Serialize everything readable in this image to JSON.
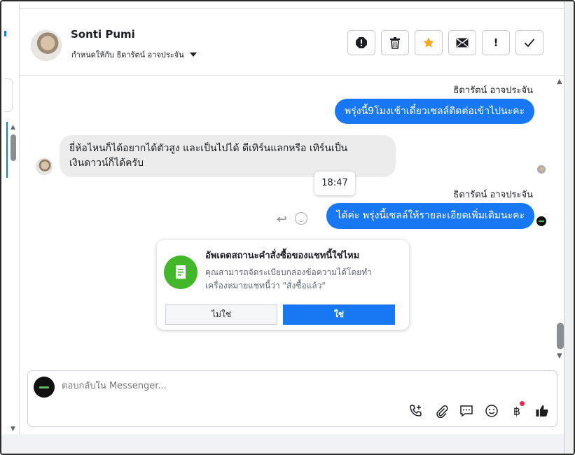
{
  "header": {
    "contact_name": "Sonti Pumi",
    "assign_label": "กำหนดให้กับ ธิดารัตน์ อาจประจัน",
    "actions": [
      {
        "icon": "alert-circle-icon",
        "glyph": "!"
      },
      {
        "icon": "trash-icon",
        "glyph": ""
      },
      {
        "icon": "star-icon",
        "glyph": "★"
      },
      {
        "icon": "envelope-icon",
        "glyph": "✉"
      },
      {
        "icon": "exclamation-icon",
        "glyph": "!"
      },
      {
        "icon": "check-icon",
        "glyph": "✓"
      }
    ]
  },
  "messages": {
    "m1_sender": "ธิดารัตน์ อาจประจัน",
    "m1_text": "พรุ่งนี้9โมงเช้าเดี๋ยวเซลล์ติดต่อเข้าไปนะคะ",
    "m2_text_line1": "ยี่ห้อไหนก็ได้อยากได้ตัวสูง และเป็นไปได้ ดีเทิร์นแลกหรือ เทิร์นเป็น",
    "m2_text_line2": "เงินดาวน์ก็ได้ครับ",
    "timestamp": "18:47",
    "m3_sender": "ธิดารัตน์ อาจประจัน",
    "m3_text": "ได้ค่ะ พรุ่งนี้เซลล์ให้รายละเอียดเพิ่มเติมนะคะ"
  },
  "order_card": {
    "title": "อัพเดตสถานะคำสั่งซื้อของแชทนี้ใช่ไหม",
    "description": "คุณสามารถจัดระเบียบกล่องข้อความได้โดยทำเครื่องหมายแชทนี้ว่า \"สั่งซื้อแล้ว\"",
    "no_label": "ไม่ใช่",
    "yes_label": "ใช่"
  },
  "composer": {
    "placeholder": "ตอบกลับใน Messenger...",
    "tools": [
      "phone-plus-icon",
      "paperclip-icon",
      "chat-bubble-icon",
      "smiley-icon",
      "baht-icon",
      "thumbs-up-icon"
    ]
  },
  "colors": {
    "accent": "#1877f2",
    "card_icon": "#42b72a",
    "star": "#f5a623",
    "notification": "#f02849"
  }
}
